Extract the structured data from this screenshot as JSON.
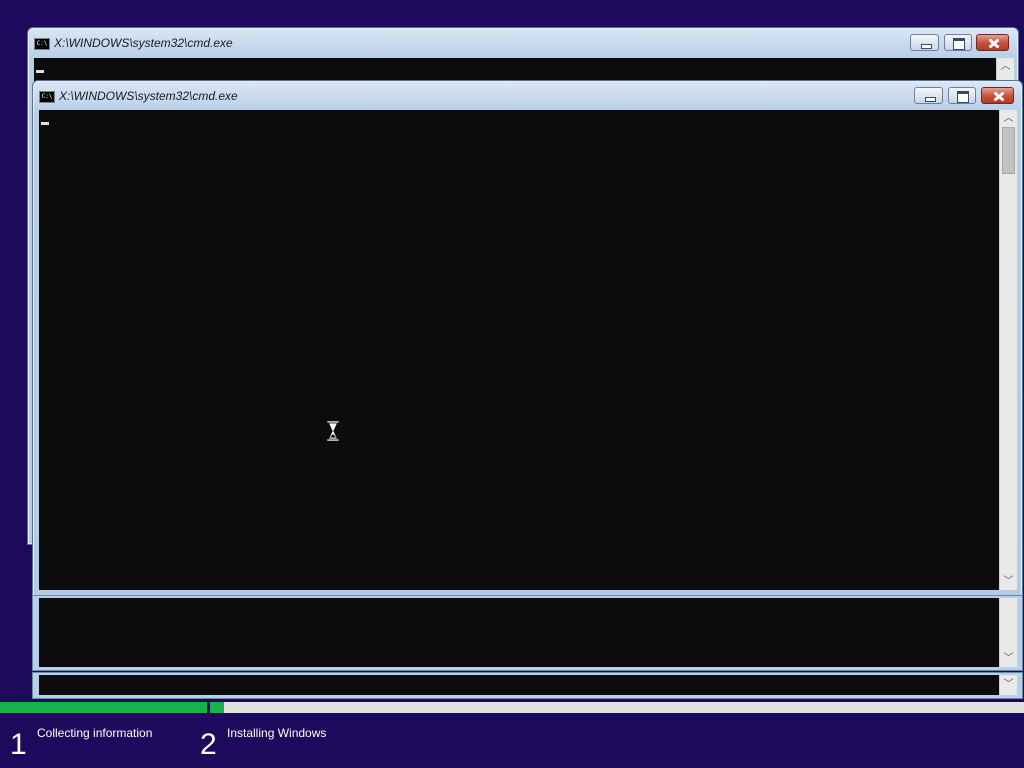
{
  "back_window": {
    "title": "X:\\WINDOWS\\system32\\cmd.exe",
    "icon": "cmd-icon",
    "controls": {
      "minimize": "minimize",
      "maximize": "maximize",
      "close": "close"
    }
  },
  "front_window": {
    "title": "X:\\WINDOWS\\system32\\cmd.exe",
    "icon": "cmd-icon",
    "controls": {
      "minimize": "minimize",
      "maximize": "maximize",
      "close": "close"
    },
    "console_text": ""
  },
  "cursor": {
    "icon": "hourglass-icon",
    "state": "busy"
  },
  "setup_progress": {
    "steps": [
      {
        "number": "1",
        "label": "Collecting information"
      },
      {
        "number": "2",
        "label": "Installing Windows"
      }
    ],
    "progress": [
      {
        "step": 1,
        "fraction": 1.0
      },
      {
        "step": 2,
        "fraction": 0.018
      }
    ]
  },
  "colors": {
    "background": "#1e0a5c",
    "progress_fill": "#17b24a",
    "progress_track": "#e2e2e2",
    "console": "#0c0c0c"
  }
}
